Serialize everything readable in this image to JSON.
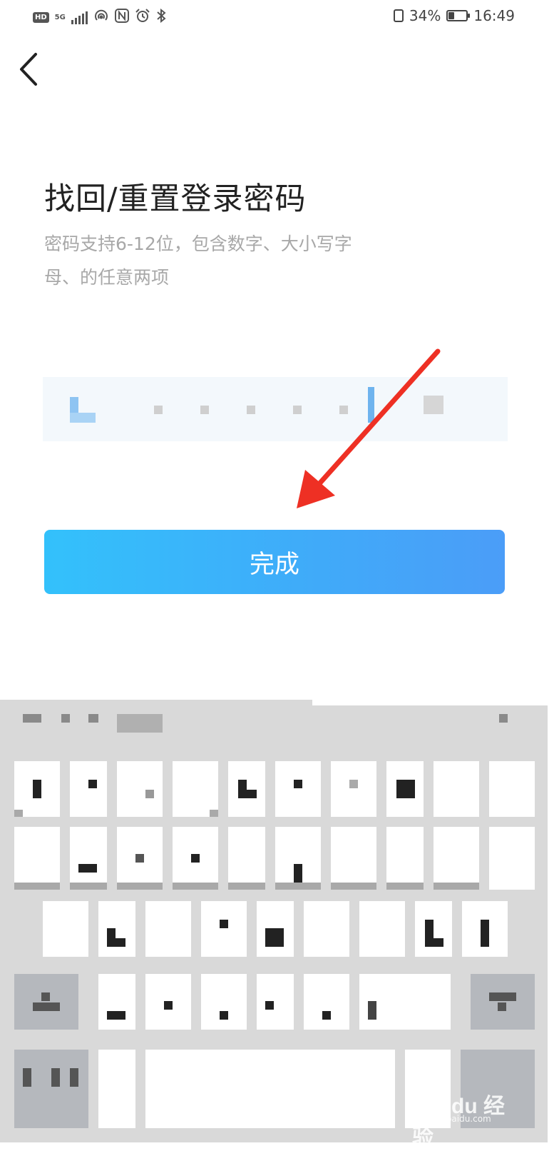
{
  "status_bar": {
    "hd": "HD",
    "net": "5G",
    "battery_percent": "34%",
    "battery_level": 0.34,
    "time": "16:49",
    "icons": [
      "hd-icon",
      "signal-icon",
      "hotspot-icon",
      "nfc-icon",
      "alarm-icon",
      "bluetooth-icon",
      "vibrate-icon",
      "battery-icon"
    ]
  },
  "nav": {
    "back_icon": "chevron-left-icon"
  },
  "page": {
    "title": "找回/重置登录密码",
    "hint": "密码支持6-12位，包含数字、大小写字母、的任意两项"
  },
  "password_field": {
    "masked_char_count": 5,
    "toggle_icon": "eye-icon"
  },
  "done_button": {
    "label": "完成"
  },
  "colors": {
    "button_start": "#33c1fb",
    "button_end": "#4b9df8",
    "field_bg": "#f3f8fc",
    "caret": "#6eb3ee",
    "annotation_arrow": "#ee3024",
    "keyboard_bg": "#d9d9d9"
  },
  "keyboard": {
    "toolbar_icon": "menu-icon",
    "shift_icon": "shift-icon",
    "backspace_icon": "backspace-icon",
    "symbols_icon": "symbols-icon"
  },
  "watermark": {
    "text": "Bai du 经验",
    "sub": "jingyan.baidu.com"
  }
}
